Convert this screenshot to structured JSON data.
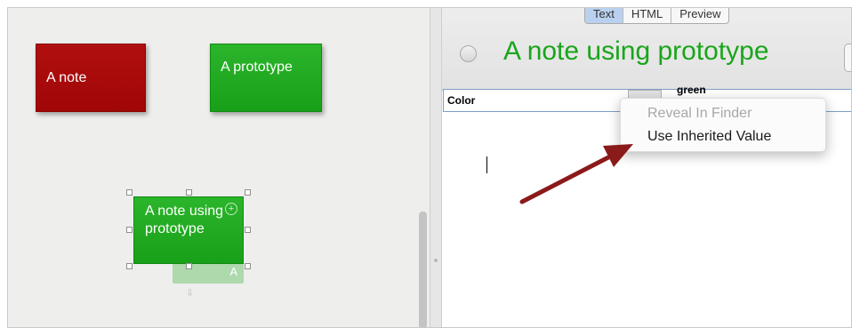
{
  "map": {
    "notes": [
      {
        "label": "A note",
        "color": "#a80a0a"
      },
      {
        "label": "A prototype",
        "color": "#1fa81f"
      },
      {
        "label": "A note using prototype",
        "color": "#1fa81f"
      }
    ],
    "child_badge": "A"
  },
  "editor": {
    "view_tabs": [
      {
        "label": "Text",
        "active": true
      },
      {
        "label": "HTML",
        "active": false
      },
      {
        "label": "Preview",
        "active": false
      }
    ],
    "note_title": "A note using prototype",
    "title_color": "#1aa51a",
    "attribute_name": "Color",
    "attribute_value": "green"
  },
  "context_menu": {
    "items": [
      {
        "label": "Reveal In Finder",
        "enabled": false
      },
      {
        "label": "Use Inherited Value",
        "enabled": true
      }
    ]
  },
  "annotation": {
    "arrow_color": "#8b1a1a"
  }
}
